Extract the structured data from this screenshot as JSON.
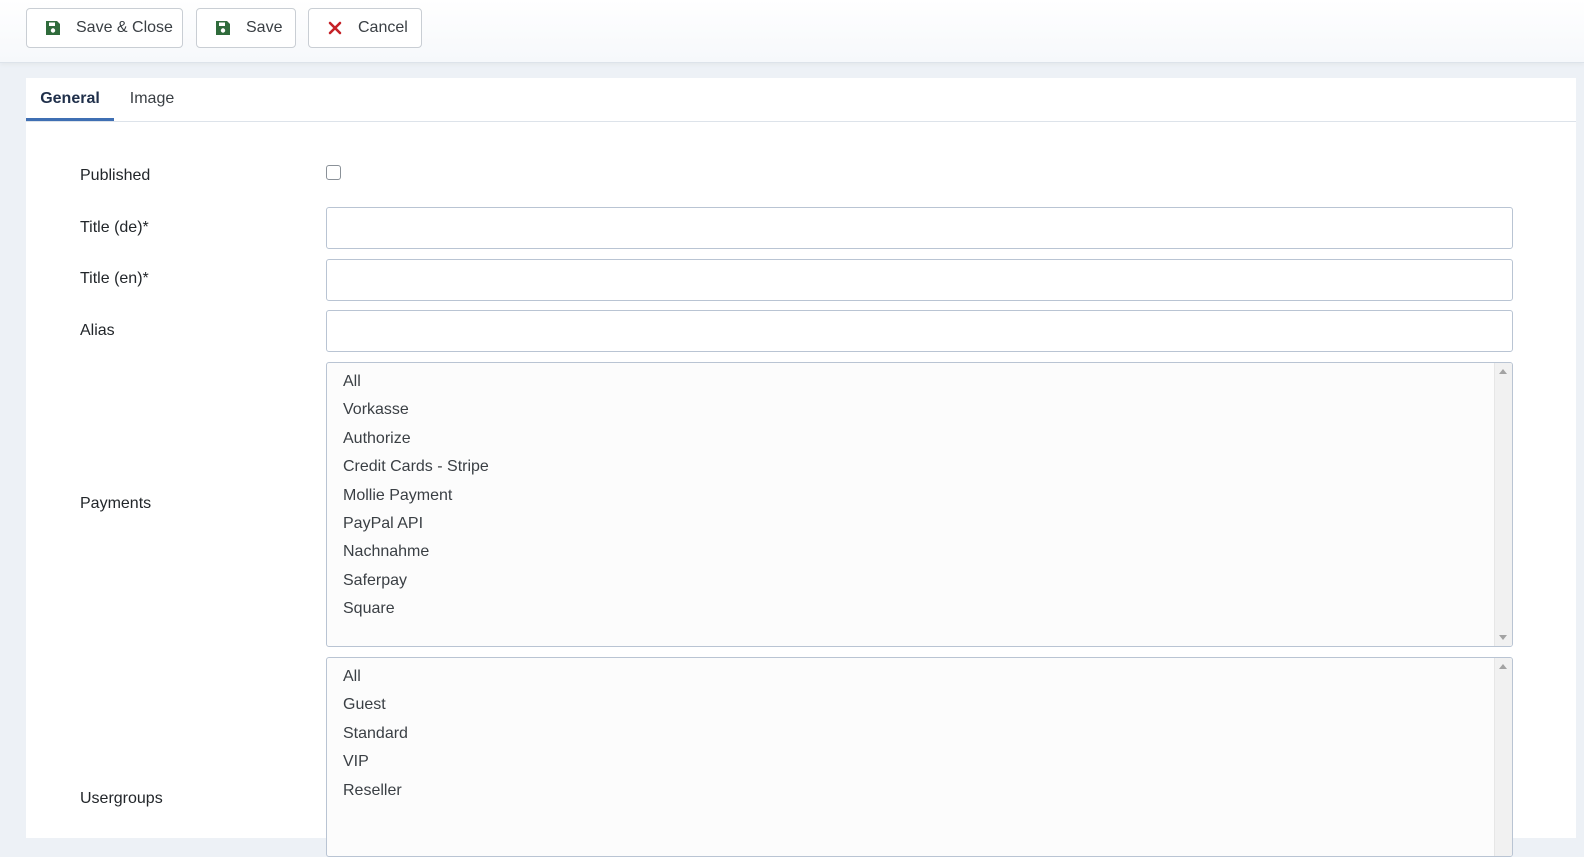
{
  "toolbar": {
    "save_close_label": "Save & Close",
    "save_label": "Save",
    "cancel_label": "Cancel",
    "icons": {
      "save": "floppy-disk-icon",
      "cancel": "close-x-icon"
    },
    "colors": {
      "save_icon": "#2f6b3b",
      "cancel_icon": "#c52127"
    }
  },
  "tabs": [
    {
      "label": "General",
      "active": true
    },
    {
      "label": "Image",
      "active": false
    }
  ],
  "form": {
    "published": {
      "label": "Published",
      "checked": false
    },
    "title_de": {
      "label": "Title (de)*",
      "value": ""
    },
    "title_en": {
      "label": "Title (en)*",
      "value": ""
    },
    "alias": {
      "label": "Alias",
      "value": ""
    },
    "payments": {
      "label": "Payments",
      "options": [
        "All",
        "Vorkasse",
        "Authorize",
        "Credit Cards - Stripe",
        "Mollie Payment",
        "PayPal API",
        "Nachnahme",
        "Saferpay",
        "Square"
      ]
    },
    "usergroups": {
      "label": "Usergroups",
      "options": [
        "All",
        "Guest",
        "Standard",
        "VIP",
        "Reseller"
      ]
    }
  },
  "colors": {
    "page_background": "#edf1f6",
    "active_tab_underline": "#3f6fb3",
    "input_border": "#b9c4d3"
  }
}
